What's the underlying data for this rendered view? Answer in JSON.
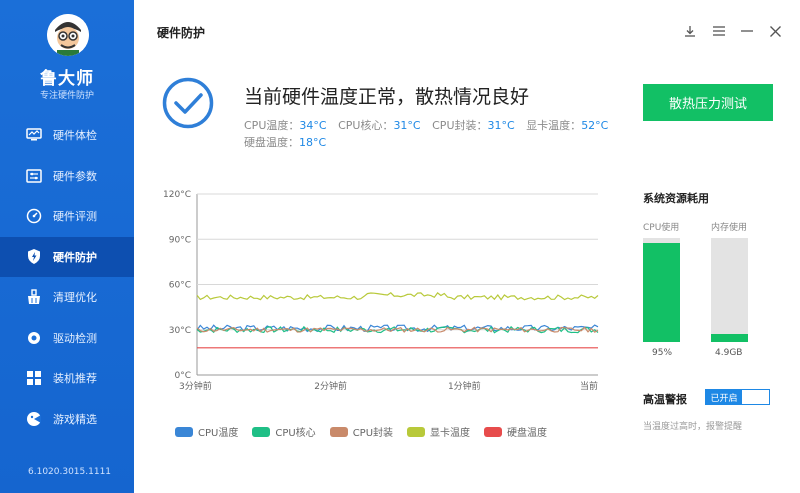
{
  "app": {
    "brand": "鲁大师",
    "brand_sub": "专注硬件防护",
    "version": "6.1020.3015.1111"
  },
  "sidebar": {
    "items": [
      {
        "label": "硬件体检",
        "icon": "monitor-icon"
      },
      {
        "label": "硬件参数",
        "icon": "sliders-icon"
      },
      {
        "label": "硬件评测",
        "icon": "gauge-icon"
      },
      {
        "label": "硬件防护",
        "icon": "shield-icon",
        "active": true
      },
      {
        "label": "清理优化",
        "icon": "broom-icon"
      },
      {
        "label": "驱动检测",
        "icon": "gear-icon"
      },
      {
        "label": "装机推荐",
        "icon": "grid-icon"
      },
      {
        "label": "游戏精选",
        "icon": "gamepad-icon"
      }
    ]
  },
  "header": {
    "title": "硬件防护"
  },
  "status": {
    "headline": "当前硬件温度正常，散热情况良好",
    "temps": [
      {
        "label": "CPU温度：",
        "value": "34°C"
      },
      {
        "label": "CPU核心：",
        "value": "31°C"
      },
      {
        "label": "CPU封装：",
        "value": "31°C"
      },
      {
        "label": "显卡温度：",
        "value": "52°C"
      },
      {
        "label": "硬盘温度：",
        "value": "18°C"
      }
    ],
    "test_button": "散热压力测试"
  },
  "resources": {
    "title": "系统资源耗用",
    "cpu": {
      "label": "CPU使用",
      "value": "95%",
      "percent": 95
    },
    "mem": {
      "label": "内存使用",
      "value": "4.9GB",
      "percent": 8
    }
  },
  "alarm": {
    "title": "高温警报",
    "toggle_label": "已开启",
    "description": "当温度过高时，报警提醒"
  },
  "colors": {
    "sidebar": "#1b6fd8",
    "accent_green": "#12c065",
    "accent_blue": "#1e88e5"
  },
  "chart_data": {
    "type": "line",
    "x_tick_labels": [
      "3分钟前",
      "2分钟前",
      "1分钟前",
      "当前"
    ],
    "ylim": [
      0,
      120
    ],
    "y_ticks": [
      "0°C",
      "30°C",
      "60°C",
      "90°C",
      "120°C"
    ],
    "grid": true,
    "legend_position": "bottom",
    "series": [
      {
        "name": "CPU温度",
        "color": "#3a86d6",
        "level": 31,
        "jitter": 2.2,
        "seed": 3
      },
      {
        "name": "CPU核心",
        "color": "#1fbf86",
        "level": 30,
        "jitter": 2.0,
        "seed": 7
      },
      {
        "name": "CPU封装",
        "color": "#c98a6a",
        "level": 30,
        "jitter": 1.6,
        "seed": 11
      },
      {
        "name": "显卡温度",
        "color": "#b8c93a",
        "level": 51.5,
        "jitter": 1.6,
        "seed": 17
      },
      {
        "name": "硬盘温度",
        "color": "#e74c4c",
        "level": 18,
        "jitter": 0,
        "seed": 1
      }
    ]
  }
}
